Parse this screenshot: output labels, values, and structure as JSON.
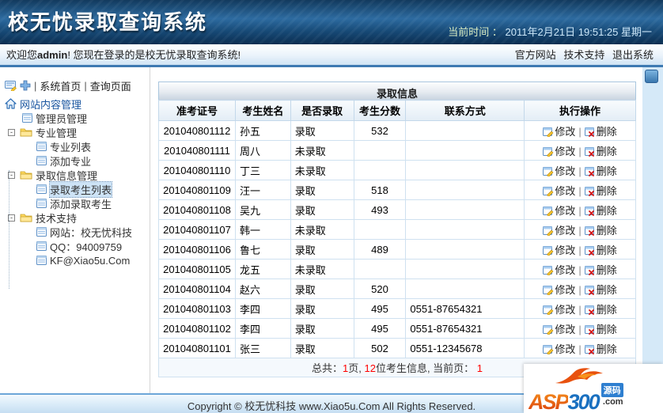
{
  "banner": {
    "title": "校无忧录取查询系统",
    "time_label": "当前时间 ：",
    "time_value": "2011年2月21日 19:51:25 星期一"
  },
  "welcome": {
    "prefix": "欢迎您",
    "username": "admin",
    "suffix": "! 您现在登录的是校无忧录取查询系统!",
    "links": {
      "official": "官方网站",
      "support": "技术支持",
      "logout": "退出系统"
    }
  },
  "sidebar": {
    "top_separator": "|",
    "top_links": [
      {
        "label": "系统首页"
      },
      {
        "label": "查询页面"
      }
    ],
    "root_label": "网站内容管理",
    "tree": [
      {
        "label": "管理员管理",
        "type": "doc",
        "level": 1,
        "selected": false
      },
      {
        "label": "专业管理",
        "type": "folder",
        "level": 1,
        "selected": false
      },
      {
        "label": "专业列表",
        "type": "doc",
        "level": 2,
        "selected": false
      },
      {
        "label": "添加专业",
        "type": "doc",
        "level": 2,
        "selected": false
      },
      {
        "label": "录取信息管理",
        "type": "folder",
        "level": 1,
        "selected": false
      },
      {
        "label": "录取考生列表",
        "type": "doc",
        "level": 2,
        "selected": true
      },
      {
        "label": "添加录取考生",
        "type": "doc",
        "level": 2,
        "selected": false
      },
      {
        "label": "技术支持",
        "type": "folder",
        "level": 1,
        "selected": false
      },
      {
        "label": "网站：校无忧科技",
        "type": "doc",
        "level": 2,
        "selected": false
      },
      {
        "label": "QQ：94009759",
        "type": "doc",
        "level": 2,
        "selected": false
      },
      {
        "label": "KF@Xiao5u.Com",
        "type": "doc",
        "level": 2,
        "selected": false
      }
    ],
    "expand_glyph": "-"
  },
  "table": {
    "title": "录取信息",
    "columns": [
      "准考证号",
      "考生姓名",
      "是否录取",
      "考生分数",
      "联系方式",
      "执行操作"
    ],
    "rows": [
      {
        "ticket": "201040801112",
        "name": "孙五",
        "admitted": "录取",
        "score": "532",
        "contact": ""
      },
      {
        "ticket": "201040801111",
        "name": "周八",
        "admitted": "未录取",
        "score": "",
        "contact": ""
      },
      {
        "ticket": "201040801110",
        "name": "丁三",
        "admitted": "未录取",
        "score": "",
        "contact": ""
      },
      {
        "ticket": "201040801109",
        "name": "汪一",
        "admitted": "录取",
        "score": "518",
        "contact": ""
      },
      {
        "ticket": "201040801108",
        "name": "吴九",
        "admitted": "录取",
        "score": "493",
        "contact": ""
      },
      {
        "ticket": "201040801107",
        "name": "韩一",
        "admitted": "未录取",
        "score": "",
        "contact": ""
      },
      {
        "ticket": "201040801106",
        "name": "鲁七",
        "admitted": "录取",
        "score": "489",
        "contact": ""
      },
      {
        "ticket": "201040801105",
        "name": "龙五",
        "admitted": "未录取",
        "score": "",
        "contact": ""
      },
      {
        "ticket": "201040801104",
        "name": "赵六",
        "admitted": "录取",
        "score": "520",
        "contact": ""
      },
      {
        "ticket": "201040801103",
        "name": "李四",
        "admitted": "录取",
        "score": "495",
        "contact": "0551-87654321"
      },
      {
        "ticket": "201040801102",
        "name": "李四",
        "admitted": "录取",
        "score": "495",
        "contact": "0551-87654321"
      },
      {
        "ticket": "201040801101",
        "name": "张三",
        "admitted": "录取",
        "score": "502",
        "contact": "0551-12345678"
      }
    ],
    "actions": {
      "edit": "修改",
      "delete": "删除",
      "separator": "|"
    },
    "pagination": {
      "total_label": "总共：",
      "page_count": "1",
      "page_unit": "页, ",
      "record_count": "12",
      "record_suffix": "位考生信息, 当前页： ",
      "current_page": "1"
    }
  },
  "footer": {
    "copyright": "Copyright © 校无忧科技  www.Xiao5u.Com All Rights Reserved."
  },
  "watermark": {
    "asp": "ASP",
    "num": "300",
    "badge": "源码",
    "tld": ".com"
  },
  "colors": {
    "banner_blue": "#2d6ba0",
    "separator_blue": "#3e7ab2",
    "table_border": "#a9c6de",
    "selected_item_bg": "#cde3f6",
    "pagination_red": "#ff0000",
    "strip_blue": "#d5e9f8"
  }
}
